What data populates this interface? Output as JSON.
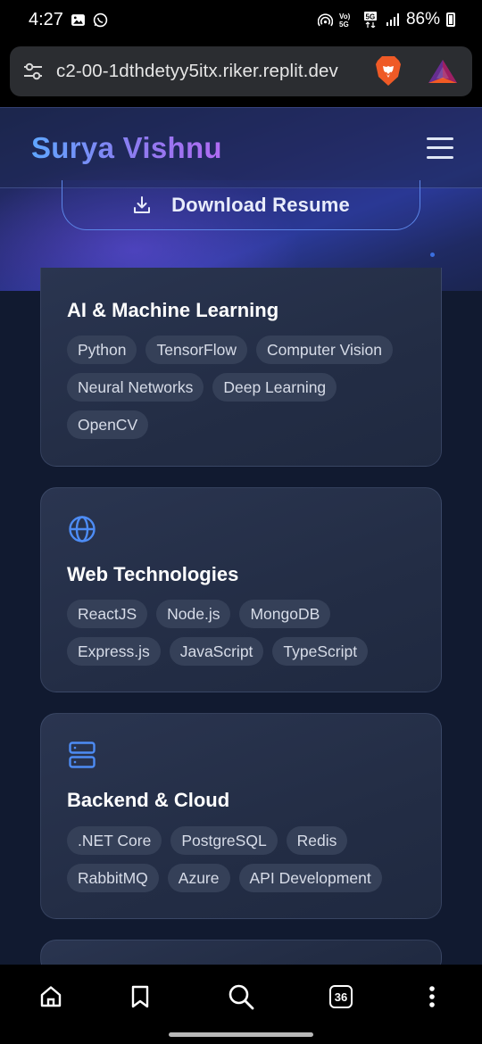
{
  "status_bar": {
    "time": "4:27",
    "battery": "86%",
    "network": "5G",
    "left_icons": [
      "image-icon",
      "whatsapp-icon"
    ],
    "right_icons": [
      "hotspot-icon",
      "volte-icon",
      "5g-icon",
      "signal-icon",
      "battery-icon"
    ]
  },
  "browser": {
    "url": "c2-00-1dthdetyy5itx.riker.replit.dev",
    "icons": [
      "site-settings-icon",
      "brave-shield-icon",
      "brave-rewards-icon"
    ]
  },
  "header": {
    "brand": "Surya Vishnu",
    "menu_icon": "hamburger-menu-icon"
  },
  "hero": {
    "download_label": "Download Resume",
    "download_icon": "download-icon"
  },
  "skills": [
    {
      "title": "AI & Machine Learning",
      "tags": [
        "Python",
        "TensorFlow",
        "Computer Vision",
        "Neural Networks",
        "Deep Learning",
        "OpenCV"
      ]
    },
    {
      "title": "Web Technologies",
      "icon": "globe-icon",
      "tags": [
        "ReactJS",
        "Node.js",
        "MongoDB",
        "Express.js",
        "JavaScript",
        "TypeScript"
      ]
    },
    {
      "title": "Backend & Cloud",
      "icon": "server-icon",
      "tags": [
        ".NET Core",
        "PostgreSQL",
        "Redis",
        "RabbitMQ",
        "Azure",
        "API Development"
      ]
    }
  ],
  "bottom_nav": {
    "tab_count": "36",
    "icons": [
      "home-icon",
      "bookmark-icon",
      "search-icon",
      "tabs-icon",
      "more-icon"
    ]
  },
  "colors": {
    "accent_blue": "#5fa6ff",
    "accent_purple": "#b06bf2",
    "page_bg": "#111a30",
    "card_bg": "#2a3550",
    "tag_bg": "#354058",
    "icon_blue": "#4d8cf5"
  }
}
